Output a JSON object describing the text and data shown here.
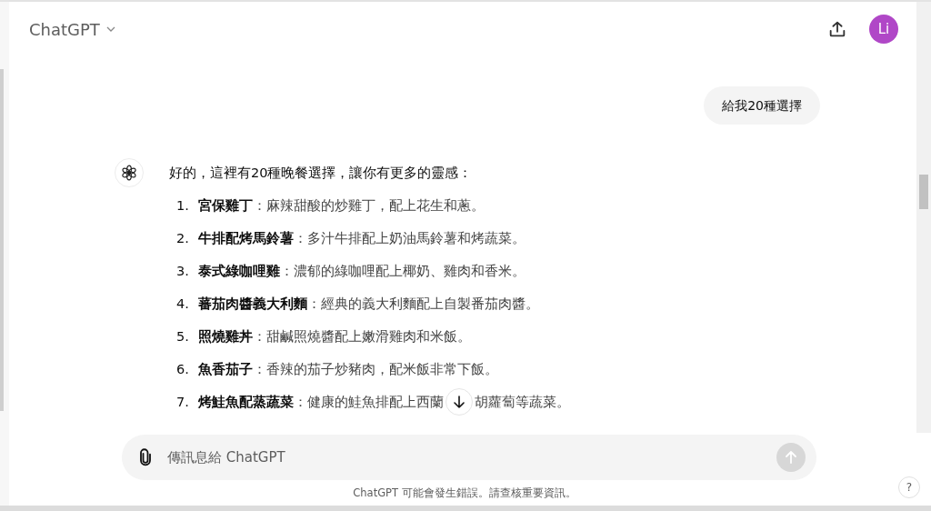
{
  "header": {
    "title": "ChatGPT",
    "avatar_initials": "Li"
  },
  "user_message": "給我20種選擇",
  "assistant": {
    "intro": "好的，這裡有20種晚餐選擇，讓你有更多的靈感：",
    "items": [
      {
        "number": "1.",
        "title": "宮保雞丁",
        "description": "：麻辣甜酸的炒雞丁，配上花生和蔥。"
      },
      {
        "number": "2.",
        "title": "牛排配烤馬鈴薯",
        "description": "：多汁牛排配上奶油馬鈴薯和烤蔬菜。"
      },
      {
        "number": "3.",
        "title": "泰式綠咖哩雞",
        "description": "：濃郁的綠咖哩配上椰奶、雞肉和香米。"
      },
      {
        "number": "4.",
        "title": "蕃茄肉醬義大利麵",
        "description": "：經典的義大利麵配上自製番茄肉醬。"
      },
      {
        "number": "5.",
        "title": "照燒雞丼",
        "description": "：甜鹹照燒醬配上嫩滑雞肉和米飯。"
      },
      {
        "number": "6.",
        "title": "魚香茄子",
        "description": "：香辣的茄子炒豬肉，配米飯非常下飯。"
      },
      {
        "number": "7.",
        "title": "烤鮭魚配蒸蔬菜",
        "description": "：健康的鮭魚排配上西蘭",
        "description_after_button": "胡蘿蔔等蔬菜。"
      }
    ]
  },
  "composer": {
    "placeholder": "傳訊息給 ChatGPT"
  },
  "footer_note": "ChatGPT 可能會發生錯誤。請查核重要資訊。",
  "help": "?"
}
